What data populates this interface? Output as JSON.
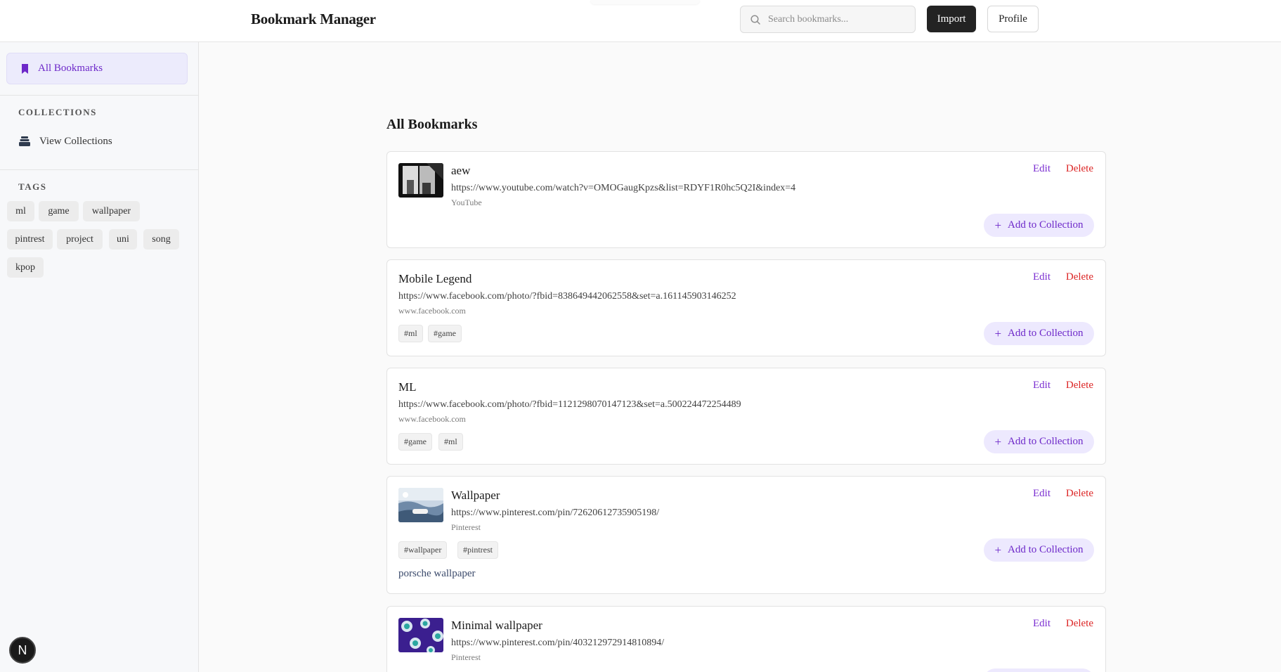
{
  "header": {
    "title": "Bookmark Manager",
    "search_placeholder": "Search bookmarks...",
    "import_label": "Import",
    "profile_label": "Profile"
  },
  "sidebar": {
    "all_bookmarks_label": "All Bookmarks",
    "collections_heading": "COLLECTIONS",
    "view_collections_label": "View Collections",
    "tags_heading": "TAGS",
    "tags": [
      "ml",
      "game",
      "wallpaper",
      "pintrest",
      "project",
      "uni",
      "song",
      "kpop"
    ]
  },
  "main": {
    "heading": "All Bookmarks",
    "edit_label": "Edit",
    "delete_label": "Delete",
    "add_to_collection_label": "Add to Collection",
    "bookmarks": [
      {
        "title": "aew",
        "url": "https://www.youtube.com/watch?v=OMOGaugKpzs&list=RDYF1R0hc5Q2I&index=4",
        "source": "YouTube",
        "tags": [],
        "note": ""
      },
      {
        "title": "Mobile Legend",
        "url": "https://www.facebook.com/photo/?fbid=838649442062558&set=a.161145903146252",
        "source": "www.facebook.com",
        "tags": [
          "#ml",
          "#game"
        ],
        "note": ""
      },
      {
        "title": "ML",
        "url": "https://www.facebook.com/photo/?fbid=1121298070147123&set=a.500224472254489",
        "source": "www.facebook.com",
        "tags": [
          "#game",
          "#ml"
        ],
        "note": ""
      },
      {
        "title": "Wallpaper",
        "url": "https://www.pinterest.com/pin/72620612735905198/",
        "source": "Pinterest",
        "tags": [
          "#wallpaper",
          "#pintrest"
        ],
        "note": "porsche wallpaper"
      },
      {
        "title": "Minimal wallpaper",
        "url": "https://www.pinterest.com/pin/403212972914810894/",
        "source": "Pinterest",
        "tags": [],
        "note": ""
      }
    ]
  },
  "dev_badge": "N",
  "colors": {
    "accent": "#6d28c9",
    "accent_bg": "#ede9fe",
    "danger": "#dc2626",
    "dark_button": "#232323"
  }
}
